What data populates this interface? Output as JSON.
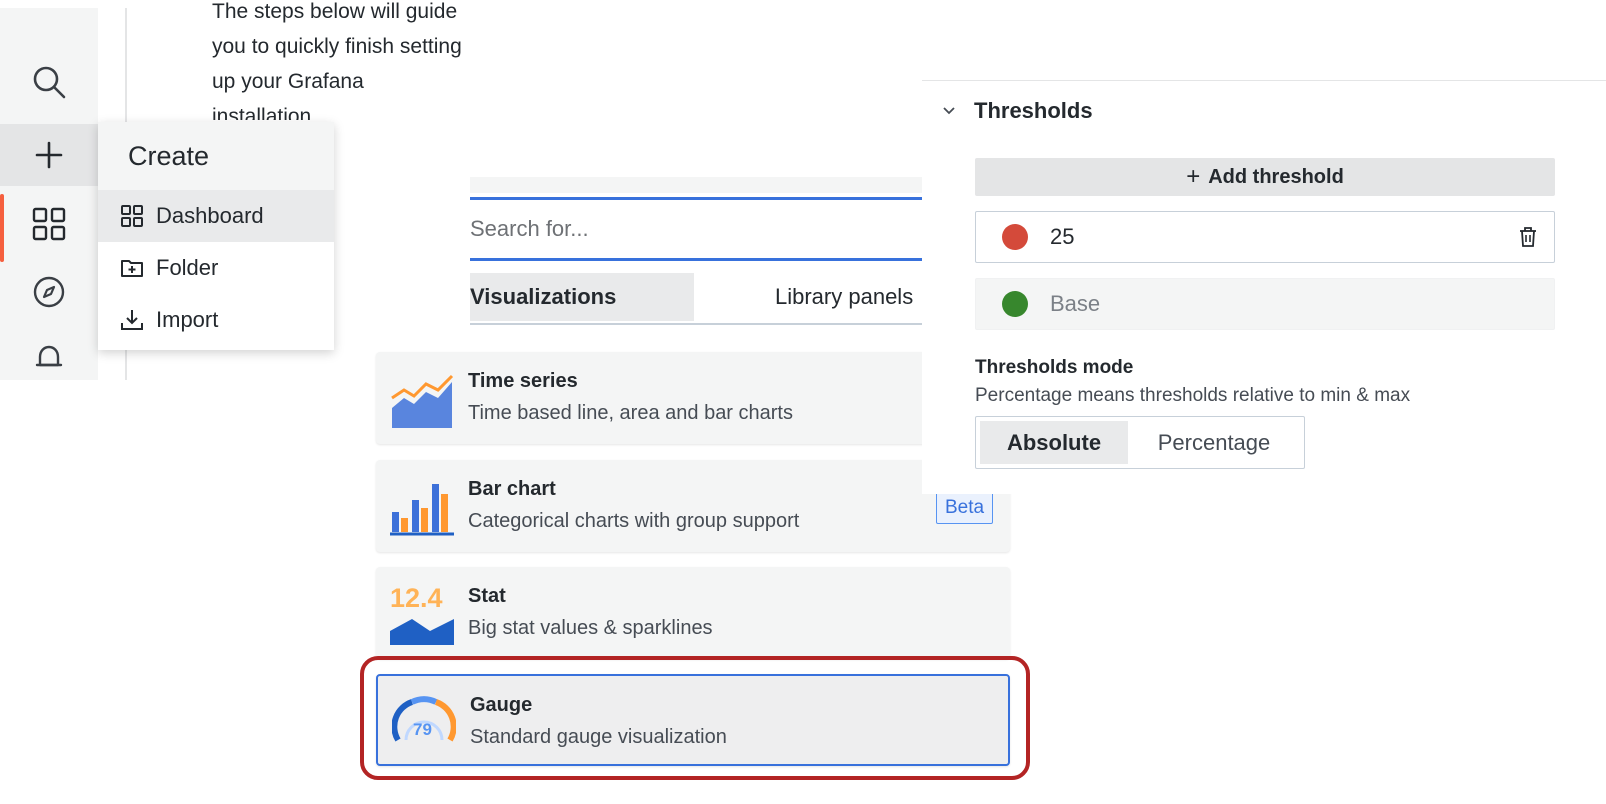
{
  "intro": {
    "text": "The steps below will guide you to quickly finish setting up your Grafana installation."
  },
  "sidebar": {
    "icons": [
      "search-icon",
      "plus-icon",
      "dashboards-icon",
      "explore-compass-icon",
      "alerting-bell-icon"
    ],
    "active_color": "#f55f3e"
  },
  "create_menu": {
    "title": "Create",
    "items": [
      {
        "label": "Dashboard",
        "icon": "dashboard-grid-icon"
      },
      {
        "label": "Folder",
        "icon": "folder-plus-icon"
      },
      {
        "label": "Import",
        "icon": "import-download-icon"
      }
    ]
  },
  "viz_picker": {
    "search_placeholder": "Search for...",
    "tabs": [
      "Visualizations",
      "Library panels"
    ],
    "items": [
      {
        "name": "Time series",
        "description": "Time based line, area and bar charts",
        "icon": "time-series-icon"
      },
      {
        "name": "Bar chart",
        "description": "Categorical charts with group support",
        "icon": "bar-chart-icon",
        "badge": "Beta"
      },
      {
        "name": "Stat",
        "description": "Big stat values & sparklines",
        "icon": "stat-icon",
        "icon_text": "12.4"
      },
      {
        "name": "Gauge",
        "description": "Standard gauge visualization",
        "icon": "gauge-icon",
        "icon_text": "79"
      }
    ],
    "accent_color": "#3871dc",
    "highlight_color": "#b32424"
  },
  "thresholds": {
    "title": "Thresholds",
    "add_label": "Add threshold",
    "rows": [
      {
        "value": "25",
        "color": "#d44a3a"
      },
      {
        "value": "Base",
        "color": "#37872d"
      }
    ],
    "mode_label": "Thresholds mode",
    "mode_description": "Percentage means thresholds relative to min & max",
    "mode_options": [
      "Absolute",
      "Percentage"
    ],
    "mode_selected": "Absolute"
  }
}
